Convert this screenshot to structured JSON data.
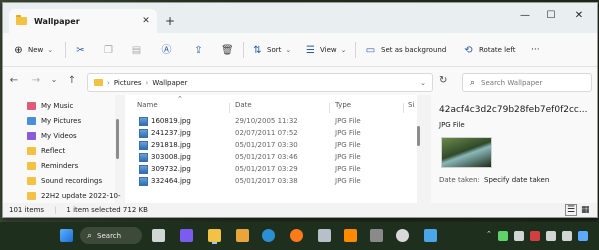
{
  "window": {
    "tab_title": "Wallpaper",
    "tab_close": "✕",
    "new_tab": "+",
    "minimize": "—",
    "maximize": "☐",
    "close": "✕"
  },
  "toolbar": {
    "new_label": "New",
    "sort_label": "Sort",
    "view_label": "View",
    "set_bg_label": "Set as background",
    "rotate_label": "Rotate left",
    "more_label": "···"
  },
  "address": {
    "segments": [
      "Pictures",
      "Wallpaper"
    ],
    "search_placeholder": "Search Wallpaper"
  },
  "nav": {
    "items": [
      {
        "label": "My Music",
        "color": "#e05a7a"
      },
      {
        "label": "My Pictures",
        "color": "#4a8fd8"
      },
      {
        "label": "My Videos",
        "color": "#8b5ad8"
      },
      {
        "label": "Reflect",
        "color": "#f3c244"
      },
      {
        "label": "Reminders",
        "color": "#f3c244"
      },
      {
        "label": "Sound recordings",
        "color": "#f3c244"
      },
      {
        "label": "22H2 update 2022-10-",
        "color": "#f3c244"
      }
    ]
  },
  "columns": {
    "name": "Name",
    "date": "Date",
    "type": "Type",
    "size": "Si"
  },
  "files": [
    {
      "name": "160819.jpg",
      "date": "29/10/2005 11:32",
      "type": "JPG File"
    },
    {
      "name": "241237.jpg",
      "date": "02/07/2011 07:52",
      "type": "JPG File"
    },
    {
      "name": "291818.jpg",
      "date": "05/01/2017 03:30",
      "type": "JPG File"
    },
    {
      "name": "303008.jpg",
      "date": "05/01/2017 03:46",
      "type": "JPG File"
    },
    {
      "name": "309732.jpg",
      "date": "05/01/2017 03:29",
      "type": "JPG File"
    },
    {
      "name": "332464.jpg",
      "date": "05/01/2017 03:38",
      "type": "JPG File"
    }
  ],
  "details": {
    "filename": "42acf4c3d2c79b28feb7ef0f2cc...",
    "filetype": "JPG File",
    "date_taken_label": "Date taken:",
    "date_taken_value": "Specify date taken"
  },
  "status": {
    "item_count": "101 items",
    "selection": "1 item selected  712 KB"
  },
  "taskbar": {
    "search_label": "Search"
  }
}
